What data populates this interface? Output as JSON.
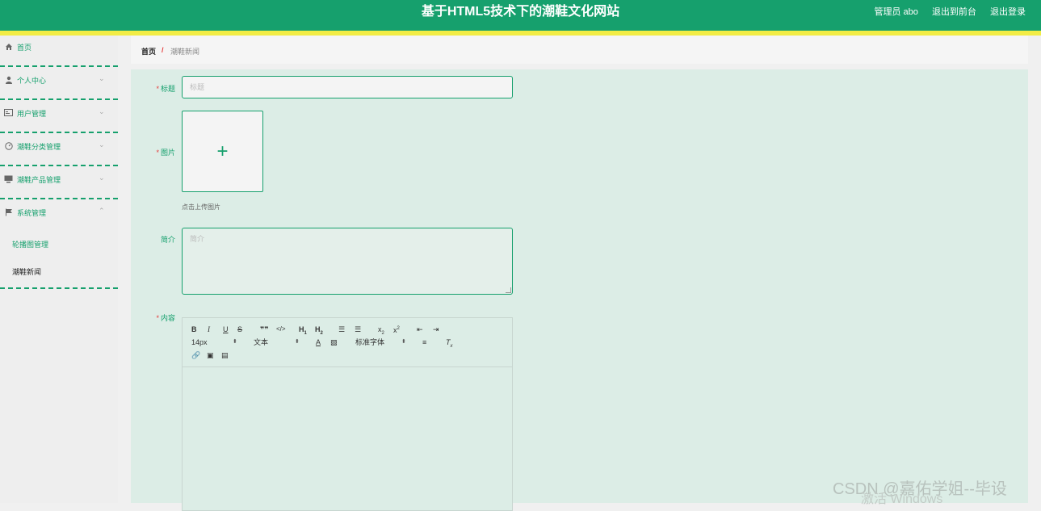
{
  "header": {
    "title": "基于HTML5技术下的潮鞋文化网站",
    "admin": "管理员 abo",
    "to_front": "退出到前台",
    "logout": "退出登录"
  },
  "sidebar": {
    "items": [
      {
        "label": "首页",
        "icon": "home-icon"
      },
      {
        "label": "个人中心",
        "icon": "user-icon"
      },
      {
        "label": "用户管理",
        "icon": "id-card-icon"
      },
      {
        "label": "潮鞋分类管理",
        "icon": "gauge-icon"
      },
      {
        "label": "潮鞋产品管理",
        "icon": "monitor-icon"
      },
      {
        "label": "系统管理",
        "icon": "flag-icon"
      }
    ],
    "submenu": [
      "轮播图管理",
      "潮鞋新闻"
    ]
  },
  "breadcrumb": {
    "home": "首页",
    "sep": "/",
    "current": "潮鞋新闻"
  },
  "form": {
    "title_label": "标题",
    "title_placeholder": "标题",
    "image_label": "图片",
    "upload_hint": "点击上传图片",
    "intro_label": "简介",
    "intro_placeholder": "简介",
    "content_label": "内容",
    "required_mark": "*"
  },
  "editor": {
    "font_size": "14px",
    "text_type": "文本",
    "font_family": "标准字体"
  },
  "watermark": {
    "csdn": "CSDN @嘉佑学姐--毕设",
    "windows": "激活 Windows"
  }
}
